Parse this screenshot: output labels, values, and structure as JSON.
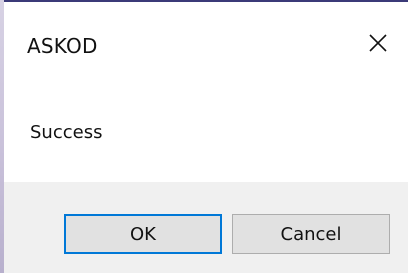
{
  "dialog": {
    "title": "ASKOD",
    "close_icon": "close-icon",
    "message": "Success",
    "buttons": {
      "ok_label": "OK",
      "cancel_label": "Cancel"
    }
  },
  "colors": {
    "accent_focus": "#0078d7",
    "button_bg": "#e1e1e1",
    "footer_bg": "#f0f0f0",
    "window_edge": "#3b3a78"
  }
}
